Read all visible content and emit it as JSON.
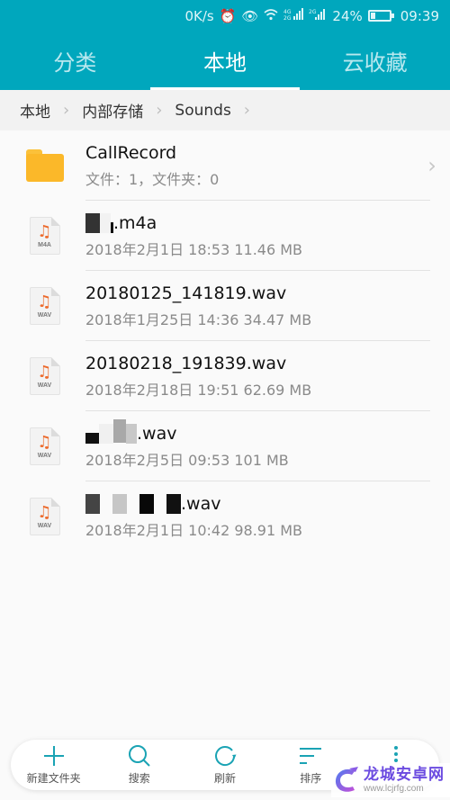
{
  "status_bar": {
    "net_speed": "0K/s",
    "sim1_label": "4G 2G",
    "sim2_label": "2G",
    "battery": "24%",
    "battery_level_percent": 24,
    "time": "09:39"
  },
  "tabs": [
    {
      "label": "分类",
      "active": false
    },
    {
      "label": "本地",
      "active": true
    },
    {
      "label": "云收藏",
      "active": false
    }
  ],
  "breadcrumb": [
    "本地",
    "内部存储",
    "Sounds"
  ],
  "folder": {
    "name": "CallRecord",
    "meta": "文件：1，文件夹：0"
  },
  "files": [
    {
      "name_suffix": ".m4a",
      "ext_badge": "M4A",
      "meta": "2018年2月1日 18:53 11.46 MB",
      "name_redacted": true
    },
    {
      "name": "20180125_141819.wav",
      "ext_badge": "WAV",
      "meta": "2018年1月25日 14:36 34.47 MB",
      "name_redacted": false
    },
    {
      "name": "20180218_191839.wav",
      "ext_badge": "WAV",
      "meta": "2018年2月18日 19:51 62.69 MB",
      "name_redacted": false
    },
    {
      "name_suffix": ".wav",
      "ext_badge": "WAV",
      "meta": "2018年2月5日 09:53 101 MB",
      "name_redacted": true
    },
    {
      "name_suffix": ".wav",
      "ext_badge": "WAV",
      "meta": "2018年2月1日 10:42 98.91 MB",
      "name_redacted": true
    }
  ],
  "bottom_actions": [
    {
      "label": "新建文件夹",
      "icon": "plus-icon"
    },
    {
      "label": "搜索",
      "icon": "search-icon"
    },
    {
      "label": "刷新",
      "icon": "refresh-icon"
    },
    {
      "label": "排序",
      "icon": "sort-icon"
    },
    {
      "label": "",
      "icon": "more-icon"
    }
  ],
  "watermark": {
    "title": "龙城安卓网",
    "url": "www.lcjrfg.com"
  },
  "colors": {
    "accent": "#00a7bd",
    "folder": "#fbb829",
    "music_note": "#ec6a2c"
  }
}
